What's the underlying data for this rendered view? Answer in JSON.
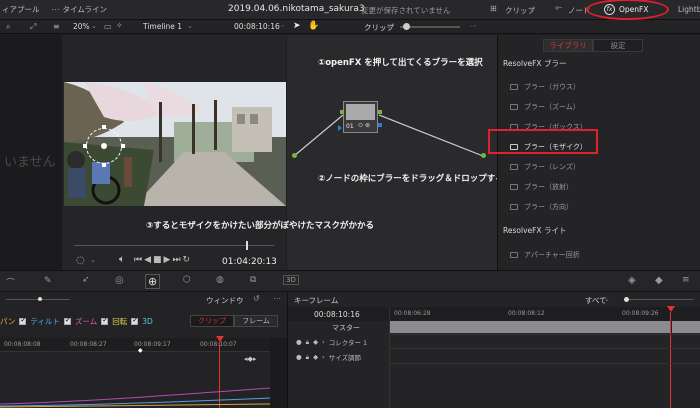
{
  "top_bar": {
    "media_pool": "ィアプール",
    "timeline": "タイムライン",
    "project_title": "2019.04.06.nikotama_sakura3",
    "unsaved": "変更が保存されていません",
    "clip": "クリップ",
    "nodes": "ノード",
    "openfx": "OpenFX",
    "lightbox": "Lightb"
  },
  "viewer_bar": {
    "zoom": "20%",
    "timeline_name": "Timeline 1",
    "timecode_top": "00:08:10:16",
    "clip_label": "クリップ"
  },
  "viewer": {
    "timecode": "01:04:20:13"
  },
  "left_panel": {
    "empty_text": "いません"
  },
  "node": {
    "label": "01"
  },
  "annotations": {
    "step1": "①openFX を押して出てくるブラーを選択",
    "step2": "②ノードの枠にブラーをドラッグ＆ドロップする",
    "step3": "③するとモザイクをかけたい部分がぼやけたマスクがかかる"
  },
  "openfx_panel": {
    "tab_library": "ライブラリ",
    "tab_settings": "設定",
    "section_blur": "ResolveFX ブラー",
    "items": [
      "ブラー（ガウス）",
      "ブラー（ズーム）",
      "ブラー（ボックス）",
      "ブラー（モザイク）",
      "ブラー（レンズ）",
      "ブラー（放射）",
      "ブラー（方向）"
    ],
    "section_light": "ResolveFX ライト",
    "light_items": [
      "アパーチャー回折"
    ]
  },
  "keyframe": {
    "window_label": "ウィンドウ",
    "tl_timecodes": [
      "00:08:08:08",
      "00:08:08:27",
      "00:08:09:17",
      "00:08:10:07"
    ],
    "filters": [
      "パン",
      "ティルト",
      "ズーム",
      "回転",
      "3D"
    ],
    "tab_clip": "クリップ",
    "tab_frame": "フレーム",
    "kf_header": "キーフレーム",
    "all_label": "すべて",
    "current_tc": "00:08:10:16",
    "master": "マスター",
    "ruler": [
      "00:08:06:28",
      "00:08:08:12",
      "00:08:09:26"
    ],
    "tracks": [
      "コレクター 1",
      "サイズ調節"
    ]
  },
  "colors": {
    "accent_red": "#e0362f",
    "node_green": "#7ab342",
    "highlight_box": "#e0202a"
  }
}
